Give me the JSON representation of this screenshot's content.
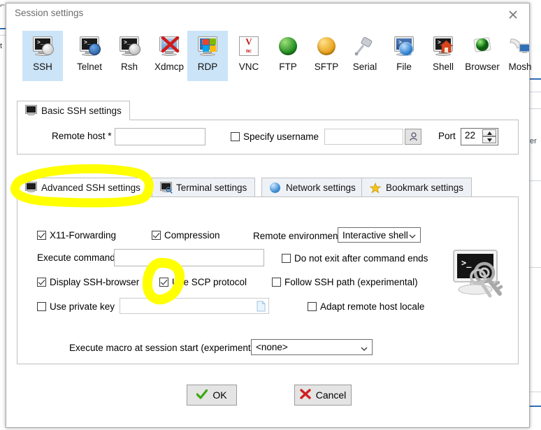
{
  "window": {
    "title": "Session settings",
    "close_icon": "close-icon"
  },
  "protocols": [
    {
      "label": "SSH",
      "icon": "ssh-monitor-icon",
      "selected": true
    },
    {
      "label": "Telnet",
      "icon": "telnet-monitor-icon",
      "selected": false
    },
    {
      "label": "Rsh",
      "icon": "rsh-monitor-icon",
      "selected": false
    },
    {
      "label": "Xdmcp",
      "icon": "xdmcp-monitor-icon",
      "selected": false
    },
    {
      "label": "RDP",
      "icon": "rdp-windows-icon",
      "selected": true
    },
    {
      "label": "VNC",
      "icon": "vnc-icon",
      "selected": false
    },
    {
      "label": "FTP",
      "icon": "ftp-globe-green-icon",
      "selected": false
    },
    {
      "label": "SFTP",
      "icon": "sftp-globe-orange-icon",
      "selected": false
    },
    {
      "label": "Serial",
      "icon": "serial-plug-icon",
      "selected": false
    },
    {
      "label": "File",
      "icon": "file-globe-icon",
      "selected": false
    },
    {
      "label": "Shell",
      "icon": "shell-house-icon",
      "selected": false
    },
    {
      "label": "Browser",
      "icon": "browser-globe-icon",
      "selected": false
    },
    {
      "label": "Mosh",
      "icon": "mosh-satellite-icon",
      "selected": false
    }
  ],
  "basic_panel": {
    "tab_label": "Basic SSH settings",
    "tab_icon": "monitor-icon",
    "remote_host_label": "Remote host *",
    "remote_host_value": "",
    "specify_username_label": "Specify username",
    "specify_username_checked": false,
    "username_value": "",
    "username_browse_icon": "user-picker-icon",
    "port_label": "Port",
    "port_value": "22"
  },
  "tabs": [
    {
      "label": "Advanced SSH settings",
      "icon": "monitor-icon",
      "active": true
    },
    {
      "label": "Terminal settings",
      "icon": "terminal-search-icon",
      "active": false
    },
    {
      "label": "Network settings",
      "icon": "globe-icon",
      "active": false
    },
    {
      "label": "Bookmark settings",
      "icon": "star-icon",
      "active": false
    }
  ],
  "advanced_panel": {
    "x11_forwarding_label": "X11-Forwarding",
    "x11_forwarding_checked": true,
    "compression_label": "Compression",
    "compression_checked": true,
    "remote_environment_label": "Remote environment",
    "remote_environment_value": "Interactive shell",
    "execute_command_label": "Execute command",
    "execute_command_value": "",
    "do_not_exit_label": "Do not exit after command ends",
    "do_not_exit_checked": false,
    "display_ssh_browser_label": "Display SSH-browser",
    "display_ssh_browser_checked": true,
    "use_scp_label": "Use SCP protocol",
    "use_scp_checked": true,
    "follow_ssh_path_label": "Follow SSH path (experimental)",
    "follow_ssh_path_checked": false,
    "use_private_key_label": "Use private key",
    "use_private_key_checked": false,
    "private_key_value": "",
    "private_key_browse_icon": "file-browse-icon",
    "adapt_locale_label": "Adapt remote host locale",
    "adapt_locale_checked": false,
    "ssh_logo_icon": "ssh-terminal-keys-icon",
    "macro_label": "Execute macro at session start (experimental):",
    "macro_value": "<none>"
  },
  "footer": {
    "ok_label": "OK",
    "ok_icon": "green-check-icon",
    "cancel_label": "Cancel",
    "cancel_icon": "red-x-icon"
  },
  "annotations": [
    {
      "name": "highlight-advanced-ssh-tab",
      "shape": "ellipse",
      "color": "#ffff00"
    },
    {
      "name": "highlight-use-scp-checkbox",
      "shape": "ellipse",
      "color": "#ffff00"
    }
  ],
  "colors": {
    "selection": "#cce4f7",
    "marker": "#ffff00",
    "panel_border": "#bfbfbf",
    "title_text": "#6d6d6d"
  }
}
